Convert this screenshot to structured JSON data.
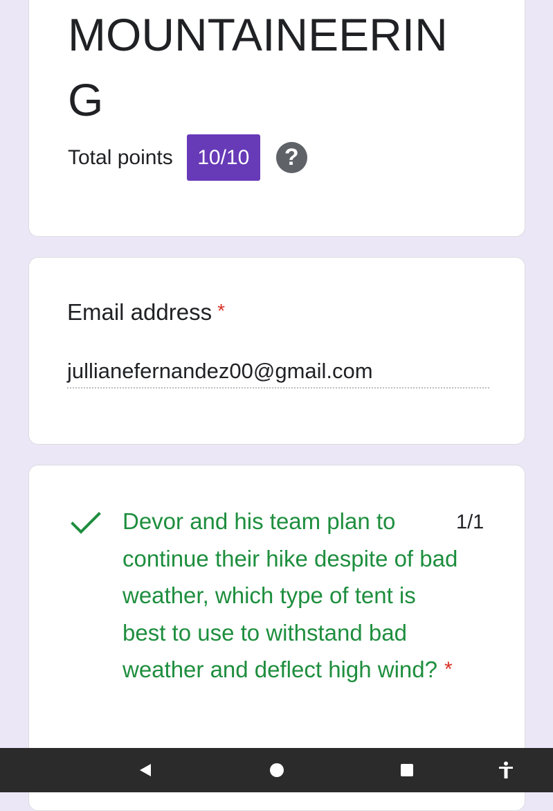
{
  "form": {
    "title": "MOUNTAINEERING",
    "total_points_label": "Total points",
    "total_points_value": "10/10",
    "help_icon": "help-circle-icon"
  },
  "email_card": {
    "label": "Email address",
    "required_mark": "*",
    "value": "jullianefernandez00@gmail.com"
  },
  "question_card": {
    "status_icon": "check-icon",
    "question": "Devor and his team plan to continue their hike despite of bad weather, which type of tent is best to use to withstand bad weather and deflect high wind?",
    "required_mark": "*",
    "score": "1/1"
  },
  "nav_bar": {
    "buttons": [
      "back-icon",
      "home-icon",
      "recents-icon",
      "accessibility-icon"
    ]
  },
  "colors": {
    "page_background": "#ece7f7",
    "accent": "#673ab7",
    "correct": "#1e8e3e",
    "required": "#d93025"
  }
}
